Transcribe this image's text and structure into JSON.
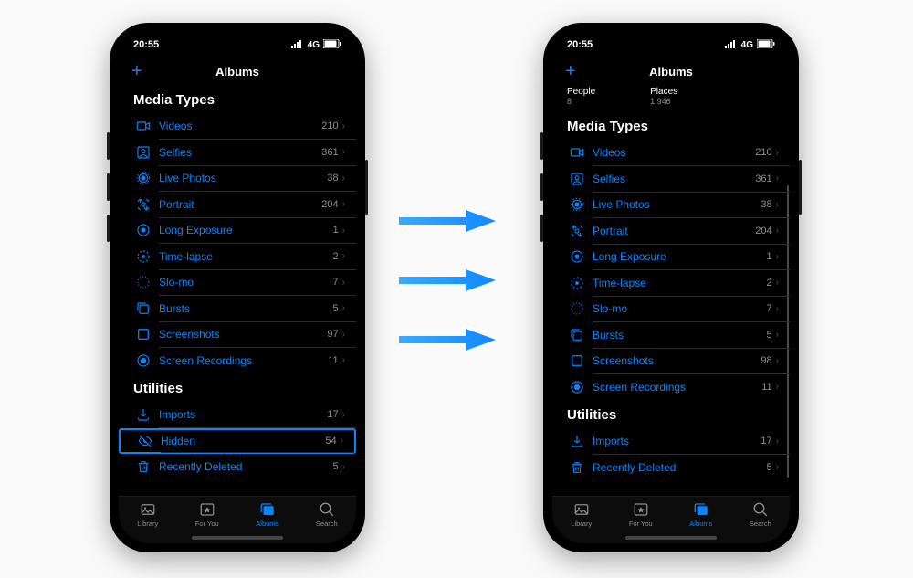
{
  "statusbar": {
    "time": "20:55",
    "network": "4G"
  },
  "navbar": {
    "title": "Albums",
    "plus": "+"
  },
  "people_places": {
    "people_label": "People",
    "people_count": "8",
    "places_label": "Places",
    "places_count": "1,946"
  },
  "sections": {
    "mediaTypes": "Media Types",
    "utilities": "Utilities"
  },
  "mediaLeft": [
    {
      "icon": "video",
      "label": "Videos",
      "count": "210"
    },
    {
      "icon": "selfie",
      "label": "Selfies",
      "count": "361"
    },
    {
      "icon": "live",
      "label": "Live Photos",
      "count": "38"
    },
    {
      "icon": "portrait",
      "label": "Portrait",
      "count": "204"
    },
    {
      "icon": "longexp",
      "label": "Long Exposure",
      "count": "1"
    },
    {
      "icon": "timelapse",
      "label": "Time-lapse",
      "count": "2"
    },
    {
      "icon": "slomo",
      "label": "Slo-mo",
      "count": "7"
    },
    {
      "icon": "bursts",
      "label": "Bursts",
      "count": "5"
    },
    {
      "icon": "screenshot",
      "label": "Screenshots",
      "count": "97"
    },
    {
      "icon": "recording",
      "label": "Screen Recordings",
      "count": "11"
    }
  ],
  "utilitiesLeft": [
    {
      "icon": "import",
      "label": "Imports",
      "count": "17"
    },
    {
      "icon": "hidden",
      "label": "Hidden",
      "count": "54",
      "highlight": true
    },
    {
      "icon": "trash",
      "label": "Recently Deleted",
      "count": "5"
    }
  ],
  "mediaRight": [
    {
      "icon": "video",
      "label": "Videos",
      "count": "210"
    },
    {
      "icon": "selfie",
      "label": "Selfies",
      "count": "361"
    },
    {
      "icon": "live",
      "label": "Live Photos",
      "count": "38"
    },
    {
      "icon": "portrait",
      "label": "Portrait",
      "count": "204"
    },
    {
      "icon": "longexp",
      "label": "Long Exposure",
      "count": "1"
    },
    {
      "icon": "timelapse",
      "label": "Time-lapse",
      "count": "2"
    },
    {
      "icon": "slomo",
      "label": "Slo-mo",
      "count": "7"
    },
    {
      "icon": "bursts",
      "label": "Bursts",
      "count": "5"
    },
    {
      "icon": "screenshot",
      "label": "Screenshots",
      "count": "98"
    },
    {
      "icon": "recording",
      "label": "Screen Recordings",
      "count": "11"
    }
  ],
  "utilitiesRight": [
    {
      "icon": "import",
      "label": "Imports",
      "count": "17"
    },
    {
      "icon": "trash",
      "label": "Recently Deleted",
      "count": "5"
    }
  ],
  "tabs": [
    {
      "label": "Library"
    },
    {
      "label": "For You"
    },
    {
      "label": "Albums",
      "active": true
    },
    {
      "label": "Search"
    }
  ],
  "chevron": "›"
}
